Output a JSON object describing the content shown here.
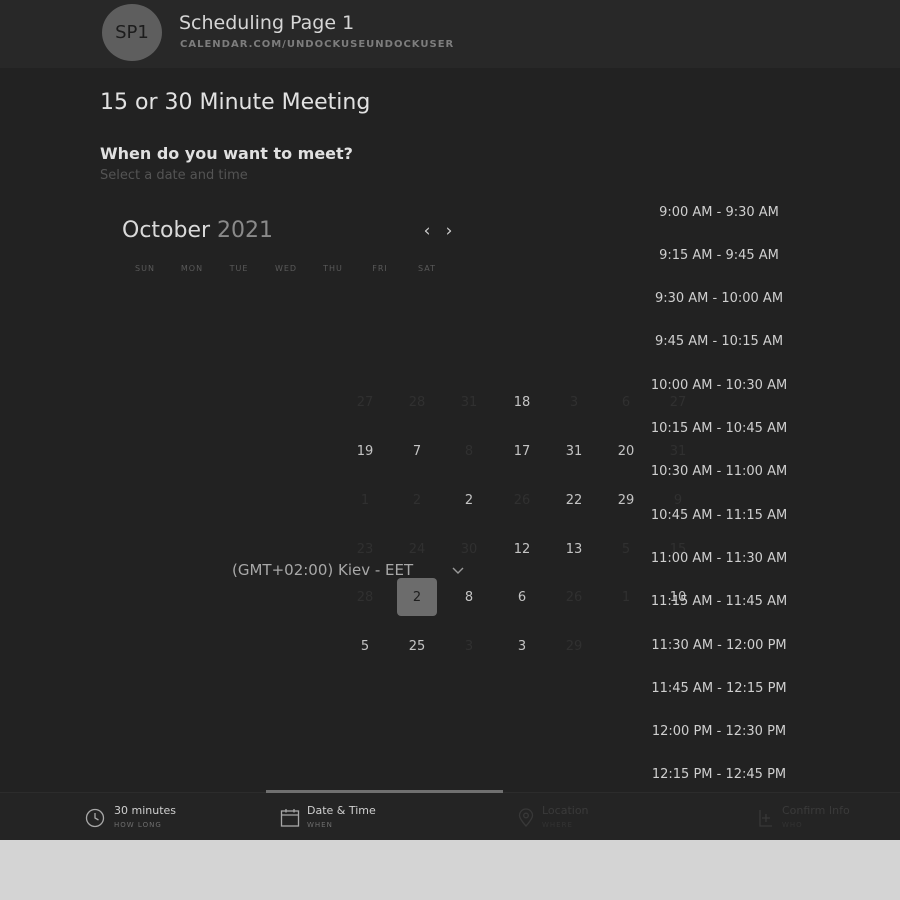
{
  "header": {
    "avatar_initials": "SP1",
    "page_name": "Scheduling Page 1",
    "page_url": "CALENDAR.COM/UNDOCKUSEUNDOCKUSER"
  },
  "event": {
    "title": "15 or 30 Minute Meeting",
    "question": "When do you want to meet?",
    "subtext": "Select a date and time"
  },
  "calendar": {
    "month": "October",
    "year": "2021",
    "prev_label": "‹",
    "next_label": "›",
    "weekdays": [
      "SUN",
      "MON",
      "TUE",
      "WED",
      "THU",
      "FRI",
      "SAT"
    ],
    "days": [
      {
        "label": "27",
        "state": "dim"
      },
      {
        "label": "28",
        "state": "dim"
      },
      {
        "label": "31",
        "state": "dim"
      },
      {
        "label": "18",
        "state": "active"
      },
      {
        "label": "3",
        "state": "dim"
      },
      {
        "label": "6",
        "state": "dim"
      },
      {
        "label": "27",
        "state": "dim"
      },
      {
        "label": "19",
        "state": "active"
      },
      {
        "label": "7",
        "state": "active"
      },
      {
        "label": "8",
        "state": "dim"
      },
      {
        "label": "17",
        "state": "active"
      },
      {
        "label": "31",
        "state": "active"
      },
      {
        "label": "20",
        "state": "active"
      },
      {
        "label": "31",
        "state": "dim"
      },
      {
        "label": "1",
        "state": "dim"
      },
      {
        "label": "2",
        "state": "dim"
      },
      {
        "label": "2",
        "state": "active"
      },
      {
        "label": "26",
        "state": "dim"
      },
      {
        "label": "22",
        "state": "active"
      },
      {
        "label": "29",
        "state": "active"
      },
      {
        "label": "9",
        "state": "dim"
      },
      {
        "label": "23",
        "state": "dim"
      },
      {
        "label": "24",
        "state": "dim"
      },
      {
        "label": "30",
        "state": "dim"
      },
      {
        "label": "12",
        "state": "active"
      },
      {
        "label": "13",
        "state": "active"
      },
      {
        "label": "5",
        "state": "dim"
      },
      {
        "label": "15",
        "state": "dim"
      },
      {
        "label": "28",
        "state": "dim"
      },
      {
        "label": "2",
        "state": "selected"
      },
      {
        "label": "8",
        "state": "active"
      },
      {
        "label": "6",
        "state": "active"
      },
      {
        "label": "26",
        "state": "dim"
      },
      {
        "label": "1",
        "state": "dim"
      },
      {
        "label": "10",
        "state": "active"
      },
      {
        "label": "5",
        "state": "active"
      },
      {
        "label": "25",
        "state": "active"
      },
      {
        "label": "3",
        "state": "dim"
      },
      {
        "label": "3",
        "state": "active"
      },
      {
        "label": "29",
        "state": "dim"
      }
    ]
  },
  "timezone": {
    "label": "(GMT+02:00) Kiev - EET"
  },
  "time_slots": [
    "9:00 AM - 9:30 AM",
    "9:15 AM - 9:45 AM",
    "9:30 AM - 10:00 AM",
    "9:45 AM - 10:15 AM",
    "10:00 AM - 10:30 AM",
    "10:15 AM - 10:45 AM",
    "10:30 AM - 11:00 AM",
    "10:45 AM - 11:15 AM",
    "11:00 AM - 11:30 AM",
    "11:15 AM - 11:45 AM",
    "11:30 AM - 12:00 PM",
    "11:45 AM - 12:15 PM",
    "12:00 PM - 12:30 PM",
    "12:15 PM - 12:45 PM"
  ],
  "tabs": [
    {
      "label": "30 minutes",
      "sub": "HOW LONG",
      "icon": "clock-icon",
      "state": "on"
    },
    {
      "label": "Date & Time",
      "sub": "WHEN",
      "icon": "calendar-icon",
      "state": "on"
    },
    {
      "label": "Location",
      "sub": "WHERE",
      "icon": "location-pin-icon",
      "state": "off"
    },
    {
      "label": "Confirm Info",
      "sub": "WHO",
      "icon": "confirm-icon",
      "state": "off"
    }
  ],
  "colors": {
    "background": "#222222",
    "selected_day": "#6c6c6c",
    "page_footer": "#d4d4d4"
  }
}
